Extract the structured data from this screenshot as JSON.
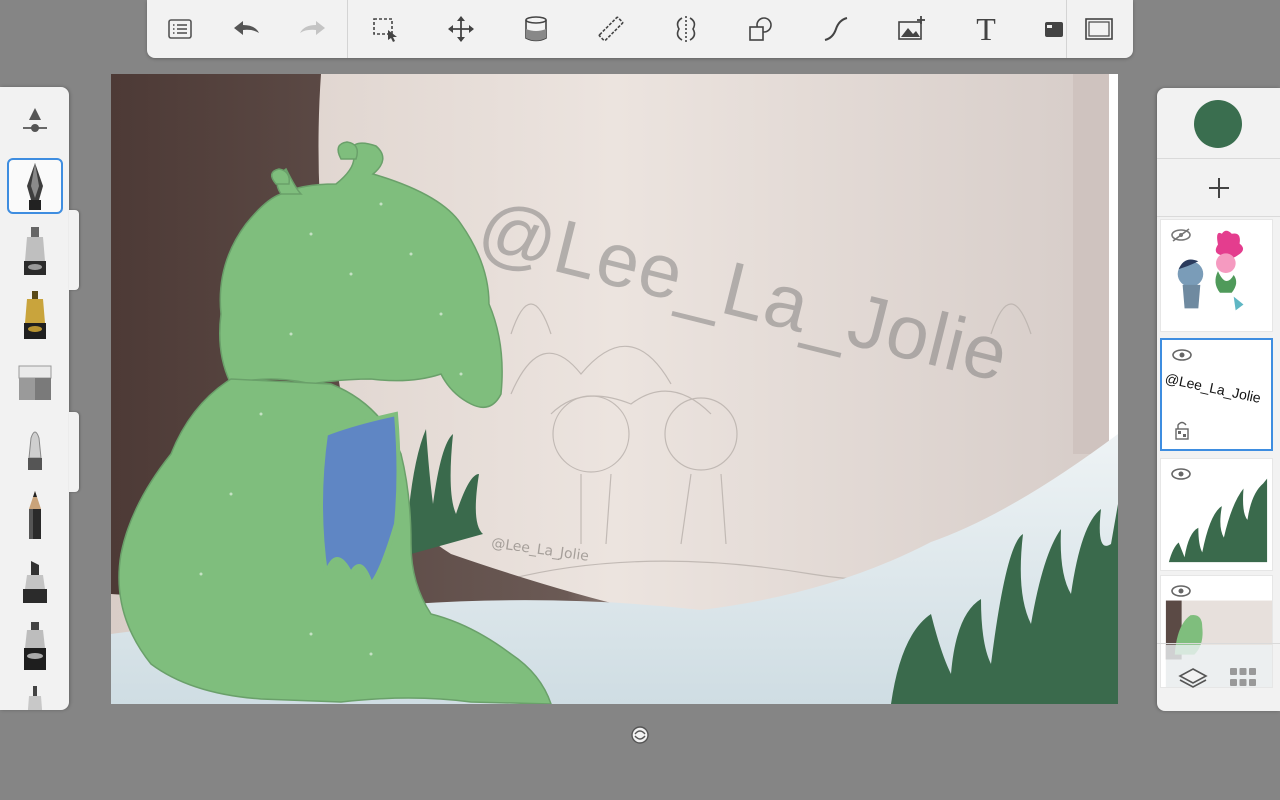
{
  "toolbar": {
    "tools": [
      {
        "name": "menu-list-icon"
      },
      {
        "name": "undo-icon"
      },
      {
        "name": "redo-icon"
      },
      {
        "name": "selection-icon"
      },
      {
        "name": "transform-move-icon"
      },
      {
        "name": "fill-bucket-icon"
      },
      {
        "name": "ruler-icon"
      },
      {
        "name": "symmetry-icon"
      },
      {
        "name": "shapes-icon"
      },
      {
        "name": "curve-icon"
      },
      {
        "name": "add-image-icon"
      },
      {
        "name": "text-icon"
      },
      {
        "name": "camera-icon"
      },
      {
        "name": "fullscreen-icon"
      }
    ],
    "text_tool_glyph": "T"
  },
  "brushes": [
    {
      "name": "brush-settings-icon"
    },
    {
      "name": "pen-nib-brush",
      "selected": true
    },
    {
      "name": "marker-brush"
    },
    {
      "name": "gold-marker-brush"
    },
    {
      "name": "eraser-brush"
    },
    {
      "name": "airbrush-brush"
    },
    {
      "name": "pencil-brush"
    },
    {
      "name": "chisel-marker-brush"
    },
    {
      "name": "paint-marker-brush"
    },
    {
      "name": "fineliner-brush"
    }
  ],
  "canvas": {
    "watermark": "@Lee_La_Jolie",
    "signature": "@Lee_La_Jolie"
  },
  "layers": {
    "current_color": "#3a6e4f",
    "items": [
      {
        "name": "layer-characters",
        "visible": false
      },
      {
        "name": "layer-watermark",
        "visible": true,
        "active": true,
        "text": "@Lee_La_Jolie"
      },
      {
        "name": "layer-grass",
        "visible": true
      },
      {
        "name": "layer-painting",
        "visible": true
      }
    ]
  },
  "colors": {
    "accent": "#3e8de0",
    "panel": "#f2f2f2",
    "workspace": "#858585",
    "grass": "#3a6a4c",
    "dragon_green": "#7fbe7d",
    "dragon_wing": "#5f86c4",
    "trunk": "#5b4a45"
  }
}
